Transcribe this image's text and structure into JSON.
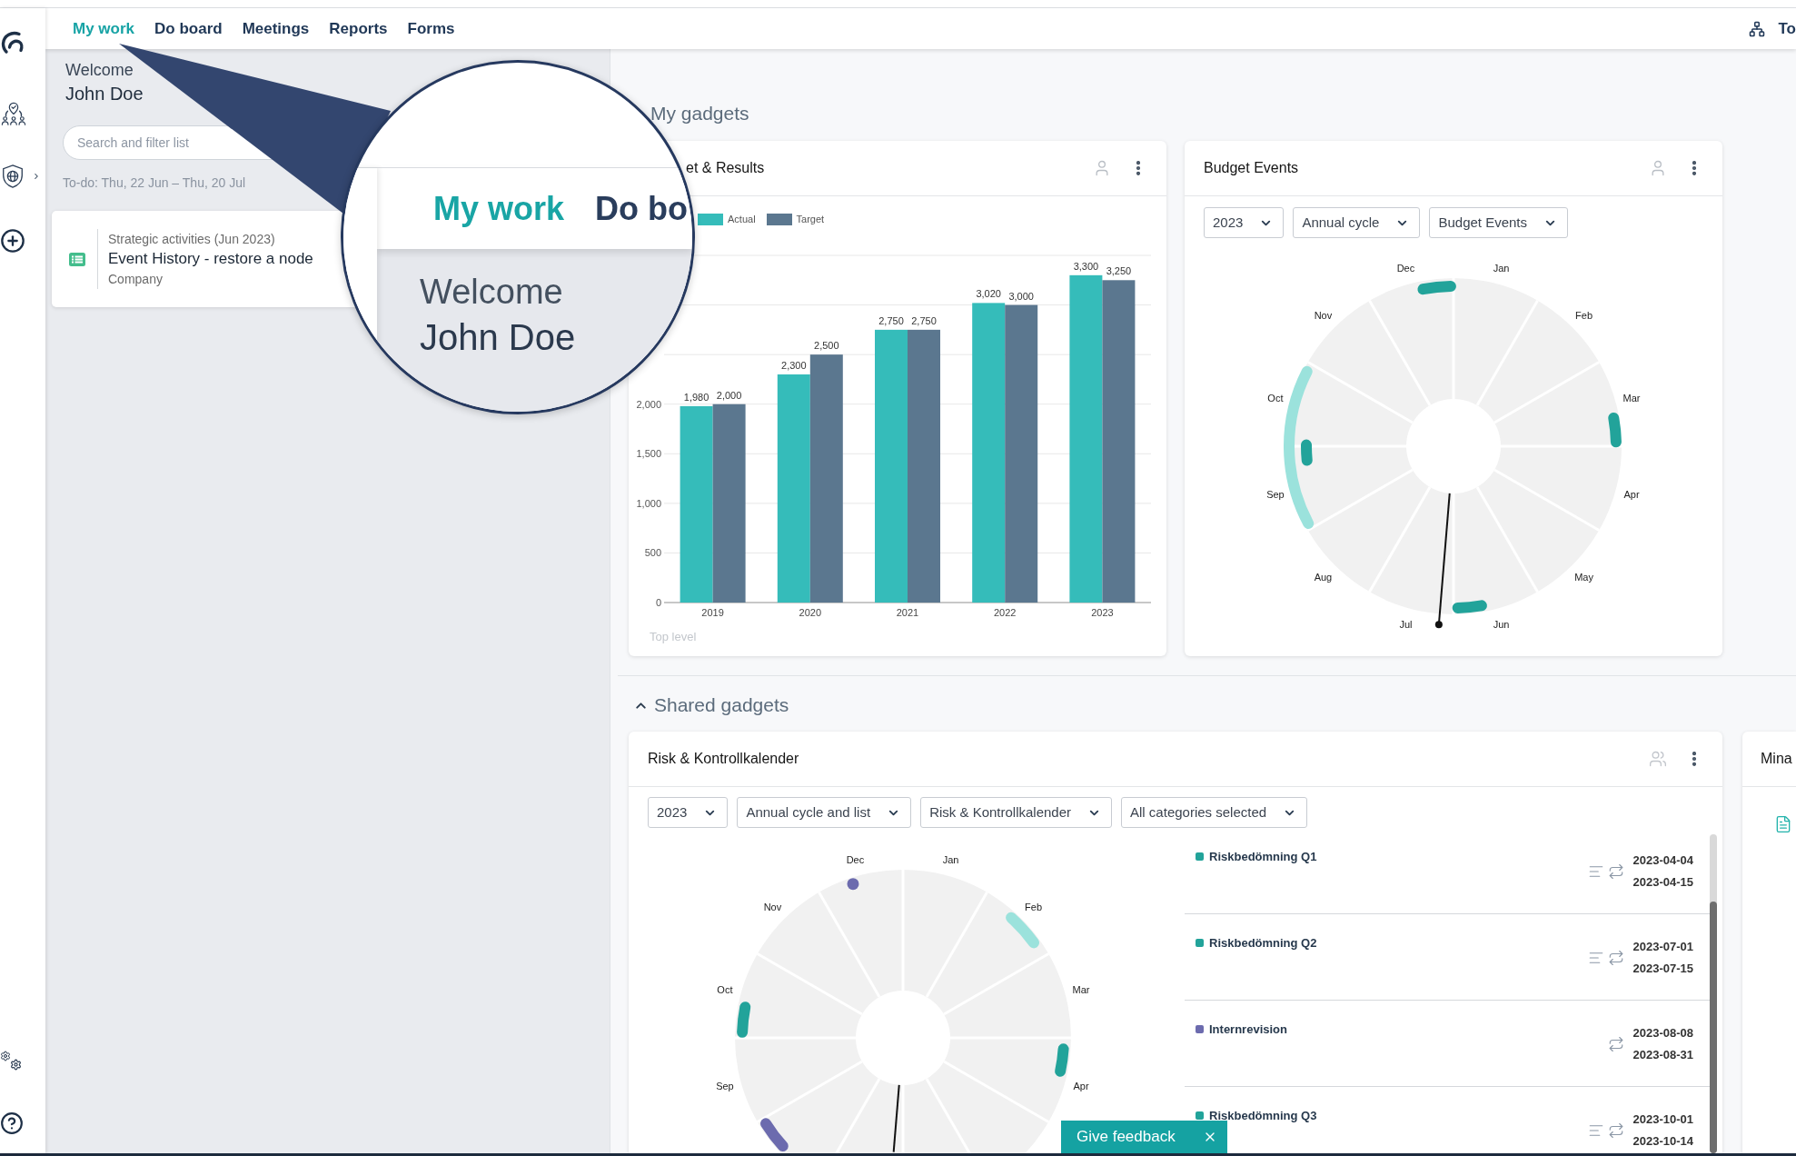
{
  "nav": {
    "tabs": [
      {
        "label": "My work",
        "selected": true
      },
      {
        "label": "Do board",
        "selected": false
      },
      {
        "label": "Meetings",
        "selected": false
      },
      {
        "label": "Reports",
        "selected": false
      },
      {
        "label": "Forms",
        "selected": false
      }
    ],
    "right_label": "To"
  },
  "sidebar": {
    "welcome": "Welcome",
    "user_name": "John Doe",
    "search": {
      "placeholder": "Search and filter list"
    },
    "todo_range": "To-do: Thu, 22 Jun – Thu, 20 Jul",
    "tasks": [
      {
        "category": "Strategic activities (Jun 2023)",
        "title": "Event History - restore a node",
        "owner": "Company"
      }
    ]
  },
  "my_gadgets": {
    "heading": "My gadgets",
    "gadgets": [
      {
        "kind": "bar_chart",
        "title": "et & Results",
        "chart_data": {
          "type": "bar",
          "categories": [
            "2019",
            "2020",
            "2021",
            "2022",
            "2023"
          ],
          "series": [
            {
              "name": "Actual",
              "color": "#35bcba",
              "values": [
                1980,
                2300,
                2750,
                3020,
                3300
              ]
            },
            {
              "name": "Target",
              "color": "#5b778f",
              "values": [
                2000,
                2500,
                2750,
                3000,
                3250
              ]
            }
          ],
          "ylim": [
            0,
            3500
          ],
          "yticks": [
            0,
            500,
            {
              "value": 1000,
              "label": "1,000"
            },
            {
              "value": 1500,
              "label": "1,500"
            },
            {
              "value": 2000,
              "label": "2,000"
            }
          ],
          "grid": true,
          "legend": "top-left",
          "value_labels": [
            [
              "1,980",
              "2,300",
              "2,750",
              "3,020",
              "3,300"
            ],
            [
              "2,000",
              "2,500",
              "2,750",
              "3,000",
              "3,250"
            ]
          ]
        },
        "footer": "Top level"
      },
      {
        "kind": "annual_wheel",
        "title": "Budget Events",
        "filters": [
          "2023",
          "Annual cycle",
          "Budget Events"
        ],
        "months": [
          "Jan",
          "Feb",
          "Mar",
          "Apr",
          "May",
          "Jun",
          "Jul",
          "Aug",
          "Sep",
          "Oct",
          "Nov",
          "Dec"
        ]
      }
    ]
  },
  "shared_gadgets": {
    "heading": "Shared gadgets",
    "expanded": true,
    "gadgets": [
      {
        "kind": "annual_wheel_list",
        "title": "Risk & Kontrollkalender",
        "filters": [
          "2023",
          "Annual cycle and list",
          "Risk & Kontrollkalender",
          "All categories selected"
        ],
        "months": [
          "Sep",
          "Oct",
          "Nov",
          "Dec",
          "Jan",
          "Feb",
          "Mar",
          "Apr"
        ],
        "items": [
          {
            "title": "Riskbedömning Q1",
            "color": "#22a39a",
            "has_description": true,
            "start": "2023-04-04",
            "end": "2023-04-15"
          },
          {
            "title": "Riskbedömning Q2",
            "color": "#22a39a",
            "has_description": true,
            "start": "2023-07-01",
            "end": "2023-07-15"
          },
          {
            "title": "Internrevision",
            "color": "#6c6bae",
            "has_description": false,
            "start": "2023-08-08",
            "end": "2023-08-31"
          },
          {
            "title": "Riskbedömning Q3",
            "color": "#22a39a",
            "has_description": true,
            "start": "2023-10-01",
            "end": "2023-10-14"
          }
        ]
      },
      {
        "kind": "documents",
        "title": "Mina"
      }
    ]
  },
  "magnifier": {
    "tabs": [
      {
        "label": "My work",
        "selected": true
      },
      {
        "label": "Do bo",
        "selected": false
      }
    ],
    "welcome": "Welcome",
    "user_name": "John Doe"
  },
  "feedback": {
    "label": "Give feedback"
  }
}
